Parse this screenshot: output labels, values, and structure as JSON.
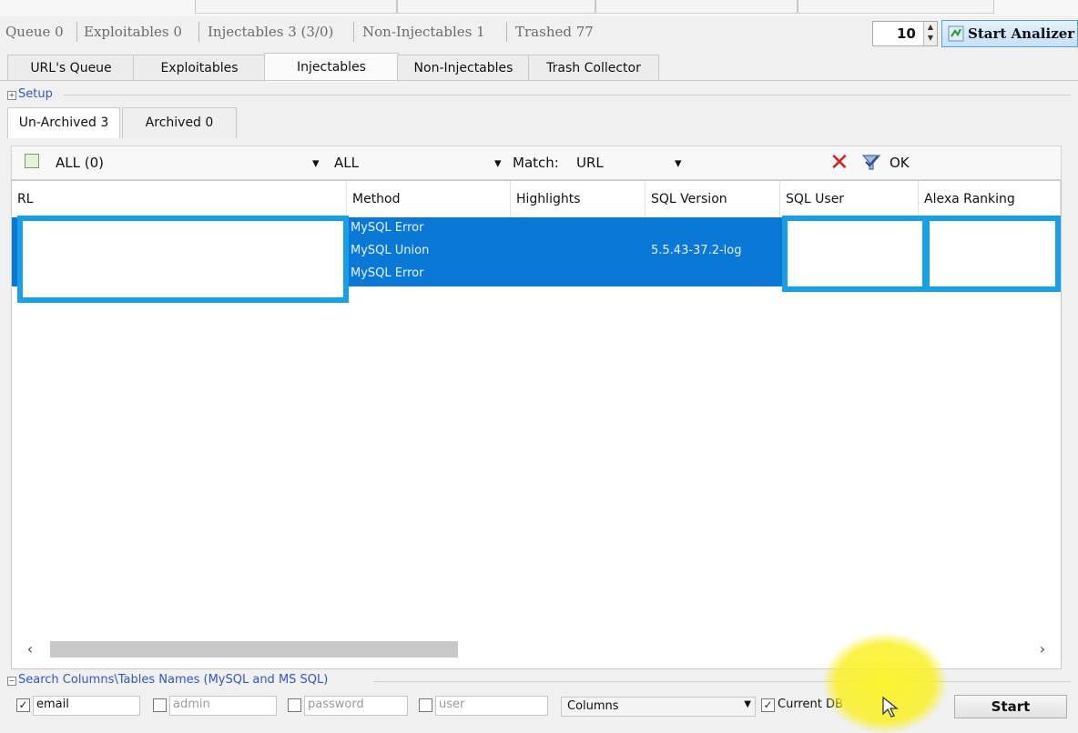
{
  "status_bar": {
    "queue": "Queue 0",
    "exploitables": "Exploitables 0",
    "injectables": "Injectables 3 (3/0)",
    "non_injectables": "Non-Injectables 1",
    "trashed": "Trashed 77"
  },
  "thread_count": "10",
  "start_analizer_label": "Start Analizer",
  "tabs": [
    {
      "label": "URL's Queue"
    },
    {
      "label": "Exploitables"
    },
    {
      "label": "Injectables",
      "active": true
    },
    {
      "label": "Non-Injectables"
    },
    {
      "label": "Trash Collector"
    }
  ],
  "setup_label": "Setup",
  "subtabs": [
    {
      "label": "Un-Archived 3",
      "active": true
    },
    {
      "label": "Archived 0"
    }
  ],
  "filter": {
    "first": "ALL (0)",
    "second": "ALL",
    "match_label": "Match:",
    "match_value": "URL",
    "ok_label": "OK"
  },
  "grid": {
    "columns": [
      "RL",
      "Method",
      "Highlights",
      "SQL Version",
      "SQL User",
      "Alexa Ranking"
    ],
    "rows": [
      {
        "methods": [
          "MySQL Error",
          "MySQL Union",
          "MySQL Error"
        ],
        "sql_version": "5.5.43-37.2-log"
      }
    ]
  },
  "search_header": "Search Columns\\Tables Names (MySQL and MS SQL)",
  "search_checks": [
    {
      "label": "email",
      "checked": true
    },
    {
      "label": "admin",
      "checked": false
    },
    {
      "label": "password",
      "checked": false
    },
    {
      "label": "user",
      "checked": false
    }
  ],
  "columns_select": "Columns",
  "current_db_label": "Current DB",
  "start_label": "Start",
  "colors": {
    "selection": "#0a78d7",
    "redaction_border": "#17a0e8",
    "link_blue": "#3355cc"
  }
}
